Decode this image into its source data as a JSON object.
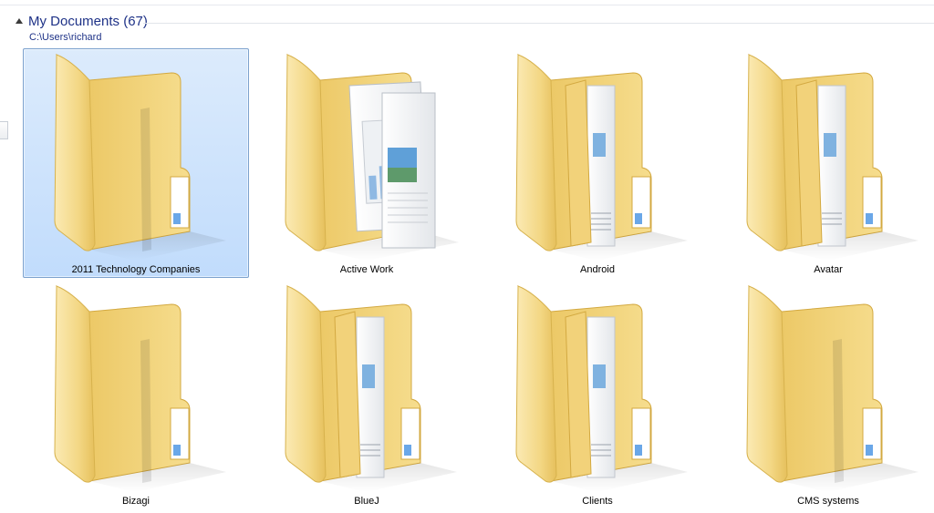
{
  "group": {
    "title": "My Documents (67)",
    "path": "C:\\Users\\richard"
  },
  "colors": {
    "header_text": "#1e3287",
    "selection_bg": "#cde3fc",
    "selection_border": "#7da2ce",
    "folder_yellow": "#f2d27a"
  },
  "folders": [
    {
      "name": "2011 Technology Companies",
      "icon": "empty-folder-icon",
      "selected": true
    },
    {
      "name": "Active Work",
      "icon": "documents-folder-icon",
      "selected": false
    },
    {
      "name": "Android",
      "icon": "folder-with-papers-icon",
      "selected": false
    },
    {
      "name": "Avatar",
      "icon": "folder-with-papers-icon",
      "selected": false
    },
    {
      "name": "Bizagi",
      "icon": "empty-folder-icon",
      "selected": false
    },
    {
      "name": "BlueJ",
      "icon": "folder-with-papers-icon",
      "selected": false
    },
    {
      "name": "Clients",
      "icon": "folder-with-papers-icon",
      "selected": false
    },
    {
      "name": "CMS systems",
      "icon": "empty-folder-icon",
      "selected": false
    }
  ]
}
